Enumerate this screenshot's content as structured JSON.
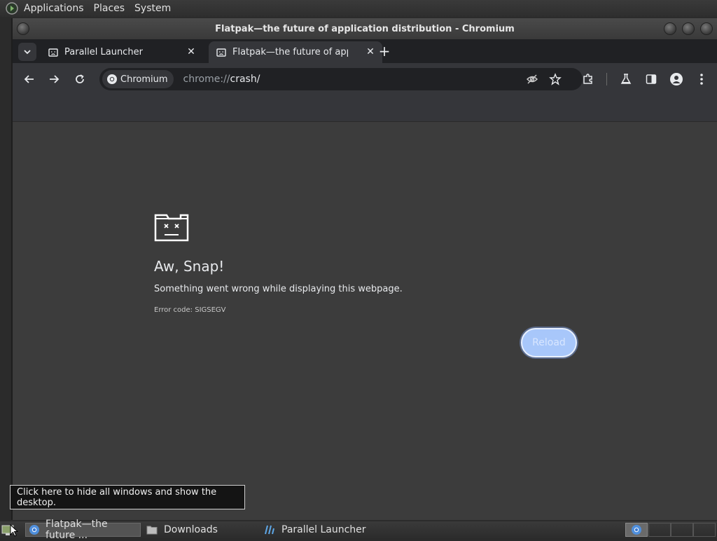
{
  "top_panel": {
    "menus": [
      "Applications",
      "Places",
      "System"
    ]
  },
  "window": {
    "title": "Flatpak—the future of application distribution - Chromium"
  },
  "tabs": [
    {
      "label": "Parallel Launcher",
      "active": false
    },
    {
      "label": "Flatpak—the future of applic",
      "active": true
    }
  ],
  "omnibox": {
    "chip_label": "Chromium",
    "url_scheme": "chrome://",
    "url_host": "crash/"
  },
  "content": {
    "heading": "Aw, Snap!",
    "message": "Something went wrong while displaying this webpage.",
    "error_code": "Error code: SIGSEGV",
    "reload_label": "Reload"
  },
  "tooltip": {
    "text": "Click here to hide all windows and show the desktop."
  },
  "taskbar": {
    "items": [
      {
        "label": "Flatpak—the future ...",
        "icon": "chromium-icon",
        "active": true
      },
      {
        "label": "Downloads",
        "icon": "folder-icon",
        "active": false
      },
      {
        "label": "Parallel Launcher",
        "icon": "parallel-launcher-icon",
        "active": false
      }
    ]
  },
  "colors": {
    "accent": "#a8c7fa",
    "page_bg": "#3c3c3c",
    "toolbar_bg": "#35363a",
    "tabstrip_bg": "#202124"
  }
}
